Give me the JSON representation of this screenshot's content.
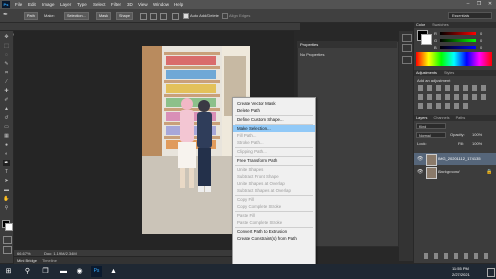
{
  "app": {
    "logo": "Ps",
    "menus": [
      "File",
      "Edit",
      "Image",
      "Layer",
      "Type",
      "Select",
      "Filter",
      "3D",
      "View",
      "Window",
      "Help"
    ],
    "window_controls": [
      "–",
      "❐",
      "✕"
    ]
  },
  "options": {
    "tool_mode": "Path",
    "make_label": "Make:",
    "selection_btn": "Selection...",
    "mask_btn": "Mask",
    "shape_btn": "Shape",
    "auto_add_delete": "Auto Add/Delete",
    "align_edges": "Align Edges",
    "workspace": "Essentials"
  },
  "document": {
    "tab_title": "IMG_20201112_174135.jpg @ 66.7% (IMG_20201112_174135 2021.jpg, RGB/8*) *",
    "zoom": "66.67%",
    "doc_size": "Doc: 1.19M/2.34M",
    "bottom_tabs": [
      "Mini Bridge",
      "Timeline"
    ]
  },
  "properties": {
    "title": "Properties",
    "body": "No Properties"
  },
  "right_panels": {
    "color_tabs": [
      "Color",
      "Swatches"
    ],
    "color_channels": [
      "R",
      "G",
      "B"
    ],
    "color_values": [
      "0",
      "0",
      "0"
    ],
    "adjust_tabs": [
      "Adjustments",
      "Styles"
    ],
    "adjust_hint": "Add an adjustment",
    "layers_tabs": [
      "Layers",
      "Channels",
      "Paths"
    ],
    "kind_label": "Kind",
    "blend_mode": "Normal",
    "opacity_label": "Opacity:",
    "opacity_value": "100%",
    "lock_label": "Lock:",
    "fill_label": "Fill:",
    "fill_value": "100%",
    "layers": [
      {
        "name": "IMG_20201112_174135",
        "selected": true
      },
      {
        "name": "Background",
        "selected": false
      }
    ]
  },
  "context_menu": {
    "items": [
      {
        "label": "Create Vector Mask",
        "enabled": true
      },
      {
        "label": "Delete Path",
        "enabled": true
      },
      {
        "sep": true
      },
      {
        "label": "Define Custom Shape...",
        "enabled": true
      },
      {
        "sep": true
      },
      {
        "label": "Make Selection...",
        "enabled": true,
        "hover": true
      },
      {
        "label": "Fill Path...",
        "enabled": false
      },
      {
        "label": "Stroke Path...",
        "enabled": false
      },
      {
        "sep": true
      },
      {
        "label": "Clipping Path...",
        "enabled": false
      },
      {
        "sep": true
      },
      {
        "label": "Free Transform Path",
        "enabled": true
      },
      {
        "sep": true
      },
      {
        "label": "Unite Shapes",
        "enabled": false
      },
      {
        "label": "Subtract Front Shape",
        "enabled": false
      },
      {
        "label": "Unite Shapes at Overlap",
        "enabled": false
      },
      {
        "label": "Subtract Shapes at Overlap",
        "enabled": false
      },
      {
        "sep": true
      },
      {
        "label": "Copy Fill",
        "enabled": false
      },
      {
        "label": "Copy Complete Stroke",
        "enabled": false
      },
      {
        "sep": true
      },
      {
        "label": "Paste Fill",
        "enabled": false
      },
      {
        "label": "Paste Complete Stroke",
        "enabled": false
      },
      {
        "sep": true
      },
      {
        "label": "Convert Path to Extrusion",
        "enabled": true
      },
      {
        "label": "Create Constraint(s) from Path",
        "enabled": true
      }
    ]
  },
  "taskbar": {
    "time": "11:55 PM",
    "date": "2/27/2021",
    "start_icon": "windows-logo",
    "search_icon": "search-icon"
  },
  "colors": {
    "menu_bg": "#535353",
    "panel_bg": "#3c3c3c",
    "canvas_bg": "#252525",
    "menu_hover": "#91c9f7",
    "ps_blue": "#31a8ff"
  }
}
